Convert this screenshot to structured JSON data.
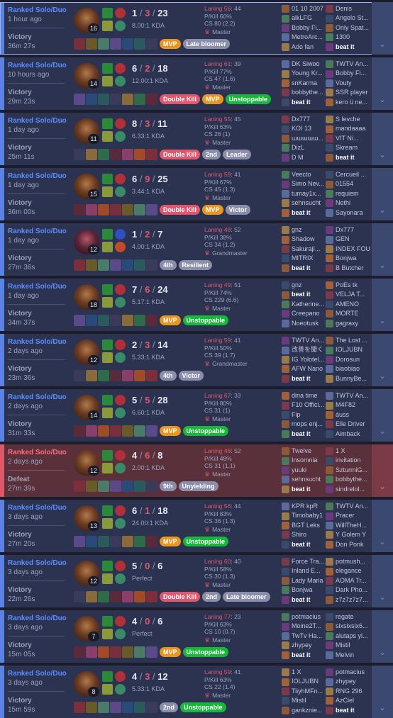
{
  "colors": {
    "win_accent": "#5b83e6",
    "loss_accent": "#e0566b",
    "mvp": "#e8961f",
    "multikill": "#e0566b",
    "positive": "#17b83a"
  },
  "matches": [
    {
      "queue": "Ranked Solo/Duo",
      "ago": "1 hour ago",
      "result": "Victory",
      "duration": "36m 27s",
      "win": true,
      "champion": {
        "level": "16",
        "icon": "champion-portrait-icon"
      },
      "kills": "1",
      "deaths": "3",
      "assists": "23",
      "kda_ratio": "8.00:1 KDA",
      "laning": "Laning 56",
      "laning_other": ": 44",
      "pkill": "P/Kill 60%",
      "cs": "CS 80 (2.2)",
      "tier": "Master",
      "badges": [
        {
          "text": "MVP",
          "color": "orange"
        },
        {
          "text": "Late bloomer",
          "color": "gray"
        }
      ],
      "team1": [
        "01 10 2007",
        "alkLFG",
        "Bobby Fi...",
        "MetroArc...",
        "Ado fan"
      ],
      "team2": [
        "Denis",
        "Angelo St...",
        "Only Spat...",
        "1300",
        "beat it"
      ]
    },
    {
      "queue": "Ranked Solo/Duo",
      "ago": "10 hours ago",
      "result": "Victory",
      "duration": "29m 23s",
      "win": true,
      "champion": {
        "level": "14",
        "icon": "champion-portrait-icon"
      },
      "kills": "6",
      "deaths": "2",
      "assists": "18",
      "kda_ratio": "12.00:1 KDA",
      "laning": "Laning 61",
      "laning_other": ": 39",
      "pkill": "P/Kill 77%",
      "cs": "CS 47 (1.6)",
      "tier": "Master",
      "badges": [
        {
          "text": "Double Kill",
          "color": "red"
        },
        {
          "text": "MVP",
          "color": "orange"
        },
        {
          "text": "Unstoppable",
          "color": "green"
        }
      ],
      "team1": [
        "DK Siwoo",
        "Young Kr...",
        "snKarma",
        "bobbythe...",
        "beat it"
      ],
      "team2": [
        "TWTV An...",
        "Bobby Fi...",
        "Vouty",
        "SSR player",
        "kero ü ne..."
      ]
    },
    {
      "queue": "Ranked Solo/Duo",
      "ago": "1 day ago",
      "result": "Victory",
      "duration": "25m 11s",
      "win": true,
      "champion": {
        "level": "11",
        "icon": "champion-portrait-icon"
      },
      "kills": "8",
      "deaths": "3",
      "assists": "11",
      "kda_ratio": "6.33:1 KDA",
      "laning": "Laning 55",
      "laning_other": ": 45",
      "pkill": "P/Kill 63%",
      "cs": "CS 26 (1)",
      "tier": "Master",
      "badges": [
        {
          "text": "Double Kill",
          "color": "red"
        },
        {
          "text": "2nd",
          "color": "gray"
        },
        {
          "text": "Leader",
          "color": "gray"
        }
      ],
      "team1": [
        "Dx777",
        "KOI 13",
        "ɯɯɯɯɯ...",
        "DizL",
        "D M"
      ],
      "team2": [
        "S levche",
        "mandaaaa",
        "VIT Ni...",
        "Skream",
        "beat it"
      ]
    },
    {
      "queue": "Ranked Solo/Duo",
      "ago": "1 day ago",
      "result": "Victory",
      "duration": "36m 00s",
      "win": true,
      "champion": {
        "level": "15",
        "icon": "champion-portrait-icon"
      },
      "kills": "6",
      "deaths": "9",
      "assists": "25",
      "kda_ratio": "3.44:1 KDA",
      "laning": "Laning 59",
      "laning_other": ": 41",
      "pkill": "P/Kill 67%",
      "cs": "CS 45 (1.3)",
      "tier": "Master",
      "badges": [
        {
          "text": "Double Kill",
          "color": "red"
        },
        {
          "text": "MVP",
          "color": "orange"
        },
        {
          "text": "Victor",
          "color": "gray"
        }
      ],
      "team1": [
        "Veecto",
        "Simo Nev...",
        "tumay1x...",
        "sehnsucht",
        "beat it"
      ],
      "team2": [
        "Cercueil ...",
        "01554",
        "requiem",
        "Nethi",
        "Sayonara"
      ]
    },
    {
      "queue": "Ranked Solo/Duo",
      "ago": "1 day ago",
      "result": "Victory",
      "duration": "27m 36s",
      "win": true,
      "champion": {
        "level": "12",
        "icon": "champion-portrait-icon",
        "alt": true
      },
      "kills": "1",
      "deaths": "2",
      "assists": "7",
      "kda_ratio": "4.00:1 KDA",
      "laning": "Laning 48",
      "laning_other": ": 52",
      "pkill": "P/Kill 38%",
      "cs": "CS 34 (1.2)",
      "tier": "Grandmaster",
      "badges": [
        {
          "text": "4th",
          "color": "gray"
        },
        {
          "text": "Resilient",
          "color": "gray"
        }
      ],
      "team1": [
        "gnz",
        "Shadow",
        "Sakurají...",
        "MITRIX",
        "beat it"
      ],
      "team2": [
        "Dx777",
        "GEN",
        "INDEX FOU",
        "Bonjwa",
        "B Butcher"
      ]
    },
    {
      "queue": "Ranked Solo/Duo",
      "ago": "1 day ago",
      "result": "Victory",
      "duration": "34m 37s",
      "win": true,
      "champion": {
        "level": "18",
        "icon": "champion-portrait-icon"
      },
      "kills": "7",
      "deaths": "6",
      "assists": "24",
      "kda_ratio": "5.17:1 KDA",
      "laning": "Laning 49",
      "laning_other": ": 51",
      "pkill": "P/Kill 74%",
      "cs": "CS 229 (6.6)",
      "tier": "Master",
      "badges": [
        {
          "text": "MVP",
          "color": "orange"
        },
        {
          "text": "Unstoppable",
          "color": "green"
        }
      ],
      "team1": [
        "gnz",
        "beat it",
        "Katherine...",
        "Creepano",
        "Noeotusk"
      ],
      "team2": [
        "PoEs tk",
        "VELJA T...",
        "AMENO",
        "MORTE",
        "gagraxy"
      ]
    },
    {
      "queue": "Ranked Solo/Duo",
      "ago": "2 days ago",
      "result": "Victory",
      "duration": "23m 36s",
      "win": true,
      "champion": {
        "level": "12",
        "icon": "champion-portrait-icon"
      },
      "kills": "2",
      "deaths": "3",
      "assists": "14",
      "kda_ratio": "5.33:1 KDA",
      "laning": "Laning 59",
      "laning_other": ": 41",
      "pkill": "P/Kill 50%",
      "cs": "CS 39 (1.7)",
      "tier": "Grandmaster",
      "badges": [
        {
          "text": "4th",
          "color": "gray"
        },
        {
          "text": "Victor",
          "color": "gray"
        }
      ],
      "team1": [
        "TWTV An...",
        "改善を聞く",
        "IG Yolotel...",
        "AFW Nano",
        "beat it"
      ],
      "team2": [
        "The Lost ...",
        "IOLJUBN",
        "Dorosun",
        "biaobiao",
        "BunnyBe..."
      ]
    },
    {
      "queue": "Ranked Solo/Duo",
      "ago": "2 days ago",
      "result": "Victory",
      "duration": "31m 33s",
      "win": true,
      "champion": {
        "level": "14",
        "icon": "champion-portrait-icon"
      },
      "kills": "5",
      "deaths": "5",
      "assists": "28",
      "kda_ratio": "6.60:1 KDA",
      "laning": "Laning 67",
      "laning_other": ": 33",
      "pkill": "P/Kill 80%",
      "cs": "CS 31 (1)",
      "tier": "Master",
      "badges": [
        {
          "text": "MVP",
          "color": "orange"
        },
        {
          "text": "Unstoppable",
          "color": "green"
        }
      ],
      "team1": [
        "dina time",
        "F10 Offici...",
        "Fip",
        "mops enj...",
        "beat it"
      ],
      "team2": [
        "TWTV An...",
        "M4F82",
        "áuss",
        "Elle Driver",
        "Aimback"
      ]
    },
    {
      "queue": "Ranked Solo/Duo",
      "ago": "2 days ago",
      "result": "Defeat",
      "duration": "27m 39s",
      "win": false,
      "champion": {
        "level": "12",
        "icon": "champion-portrait-icon"
      },
      "kills": "4",
      "deaths": "6",
      "assists": "8",
      "kda_ratio": "2.00:1 KDA",
      "laning": "Laning 48",
      "laning_other": ": 52",
      "pkill": "P/Kill 48%",
      "cs": "CS 31 (1.1)",
      "tier": "Master",
      "badges": [
        {
          "text": "9th",
          "color": "gray"
        },
        {
          "text": "Unyielding",
          "color": "gray"
        }
      ],
      "team1": [
        "Twelve",
        "Insomnia",
        "yuuki",
        "sehnsucht",
        "beat it"
      ],
      "team2": [
        "1 X",
        "invitation",
        "SzturmiG...",
        "bobbythe...",
        "sindrelol..."
      ]
    },
    {
      "queue": "Ranked Solo/Duo",
      "ago": "3 days ago",
      "result": "Victory",
      "duration": "27m 20s",
      "win": true,
      "champion": {
        "level": "13",
        "icon": "champion-portrait-icon"
      },
      "kills": "6",
      "deaths": "1",
      "assists": "18",
      "kda_ratio": "24.00:1 KDA",
      "laning": "Laning 56",
      "laning_other": ": 44",
      "pkill": "P/Kill 83%",
      "cs": "CS 36 (1.3)",
      "tier": "Master",
      "badges": [
        {
          "text": "MVP",
          "color": "orange"
        },
        {
          "text": "Unstoppable",
          "color": "green"
        }
      ],
      "team1": [
        "KPR kpR",
        "Timobaby1",
        "BGT Leks",
        "Shiro",
        "beat it"
      ],
      "team2": [
        "TWTV An...",
        "Pracer",
        "WillTheH...",
        "Y Golem Y",
        "Don Ponk"
      ]
    },
    {
      "queue": "Ranked Solo/Duo",
      "ago": "3 days ago",
      "result": "Victory",
      "duration": "22m 26s",
      "win": true,
      "champion": {
        "level": "12",
        "icon": "champion-portrait-icon"
      },
      "kills": "5",
      "deaths": "0",
      "assists": "6",
      "kda_ratio": "Perfect",
      "laning": "Laning 60",
      "laning_other": ": 40",
      "pkill": "P/Kill 58%",
      "cs": "CS 30 (1.3)",
      "tier": "Master",
      "badges": [
        {
          "text": "Double Kill",
          "color": "red"
        },
        {
          "text": "2nd",
          "color": "gray"
        },
        {
          "text": "Late bloomer",
          "color": "gray"
        }
      ],
      "team1": [
        "Force Tra...",
        "Inland E...",
        "Lady Maria",
        "Bonjwa",
        "beat it"
      ],
      "team2": [
        "potmush...",
        "elegance",
        "AOMA Tr...",
        "Dark Pho...",
        "z7z7z7z7..."
      ]
    },
    {
      "queue": "Ranked Solo/Duo",
      "ago": "3 days ago",
      "result": "Victory",
      "duration": "15m 05s",
      "win": true,
      "champion": {
        "level": "7",
        "icon": "champion-portrait-icon"
      },
      "kills": "4",
      "deaths": "0",
      "assists": "6",
      "kda_ratio": "Perfect",
      "laning": "Laning 77",
      "laning_other": ": 23",
      "pkill": "P/Kill 63%",
      "cs": "CS 10 (0.7)",
      "tier": "Master",
      "badges": [
        {
          "text": "MVP",
          "color": "orange"
        },
        {
          "text": "Unstoppable",
          "color": "green"
        }
      ],
      "team1": [
        "potmacius",
        "Moine2T...",
        "TwTv Ha...",
        "zhypey",
        "beat it"
      ],
      "team2": [
        "regate",
        "sixsixsix6...",
        "alutaps yl...",
        "Mistil",
        "Melvin"
      ]
    },
    {
      "queue": "Ranked Solo/Duo",
      "ago": "3 days ago",
      "result": "Victory",
      "duration": "15m 59s",
      "win": true,
      "champion": {
        "level": "8",
        "icon": "champion-portrait-icon"
      },
      "kills": "4",
      "deaths": "3",
      "assists": "12",
      "kda_ratio": "5.33:1 KDA",
      "laning": "Laning 59",
      "laning_other": ": 41",
      "pkill": "P/Kill 63%",
      "cs": "CS 22 (1.4)",
      "tier": "Master",
      "badges": [
        {
          "text": "2nd",
          "color": "gray"
        },
        {
          "text": "Unstoppable",
          "color": "green"
        }
      ],
      "team1": [
        "1 X",
        "IOLJUBN",
        "TiiyhMFn...",
        "Mistil",
        "gankznie..."
      ],
      "team2": [
        "potmacius",
        "zhypey",
        "RNG 296",
        "AzCiel",
        "beat it"
      ]
    }
  ]
}
